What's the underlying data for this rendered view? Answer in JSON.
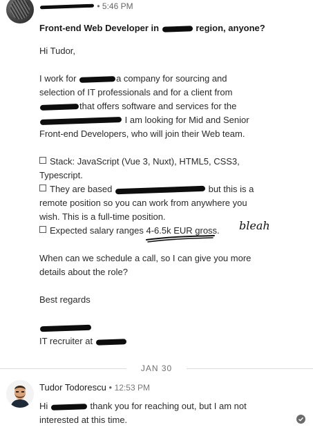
{
  "message1": {
    "time": "5:46 PM",
    "subject_before": "Front-end Web Developer in ",
    "subject_after": " region, anyone?",
    "greeting": "Hi Tudor,",
    "p1": [
      [
        "I work for ",
        "a company for sourcing and"
      ],
      [
        "selection of IT professionals and for a client from"
      ],
      [
        "",
        "that offers software and services for the"
      ],
      [
        "",
        " I am looking for Mid and Senior"
      ],
      [
        "Front-end Developers, who will join their Web team."
      ]
    ],
    "stack_1": "Stack: JavaScript (Vue 3, Nuxt), HTML5, CSS3,",
    "stack_2": "Typescript.",
    "based_1a": "They are based",
    "based_1b": "but this is a",
    "based_2": "remote position so you can work from anywhere you",
    "based_3": "wish. This is a full-time position.",
    "salary": "Expected salary ranges 4-6.5k EUR gross.",
    "handwritten_note": "bleah",
    "call_1": "When can we schedule a call, so I can give you more",
    "call_2": "details about the role?",
    "regards": "Best regards",
    "signature": "IT recruiter at"
  },
  "divider": {
    "date": "JAN 30"
  },
  "message2": {
    "sender": "Tudor Todorescu",
    "separator": " • ",
    "time": "12:53 PM",
    "line1a": "Hi",
    "line1b": "thank you for reaching out, but I am not",
    "line2": "interested at this time."
  },
  "icons": {
    "read_receipt": "check-circle-icon"
  }
}
